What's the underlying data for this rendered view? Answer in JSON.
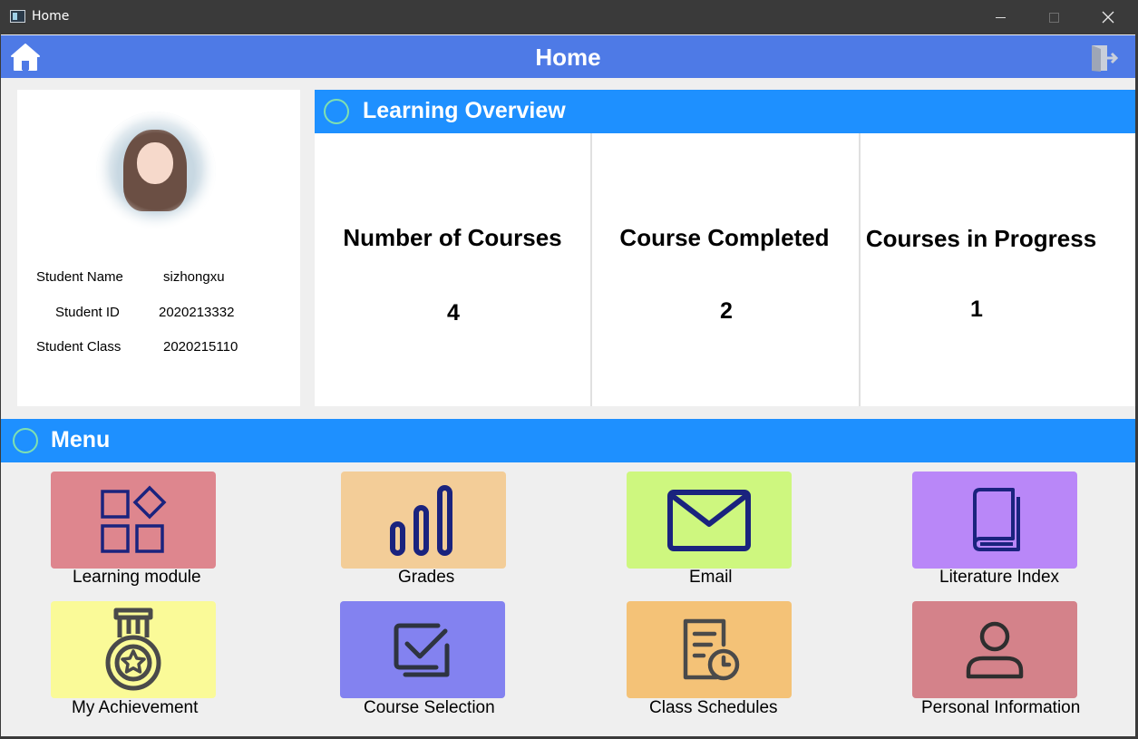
{
  "window": {
    "title": "Home"
  },
  "header": {
    "title": "Home"
  },
  "student": {
    "fields": [
      {
        "label": "Student Name",
        "value": "sizhongxu"
      },
      {
        "label": "Student ID",
        "value": "2020213332"
      },
      {
        "label": "Student Class",
        "value": "2020215110"
      }
    ]
  },
  "overview": {
    "title": "Learning Overview",
    "stats": [
      {
        "label": "Number of Courses",
        "value": "4"
      },
      {
        "label": "Course Completed",
        "value": "2"
      },
      {
        "label": "Courses in Progress",
        "value": "1"
      }
    ]
  },
  "menu": {
    "title": "Menu",
    "items": [
      {
        "label": "Learning module",
        "icon": "grid-icon",
        "color": "#de868e"
      },
      {
        "label": "Grades",
        "icon": "bar-chart-icon",
        "color": "#f3cd98"
      },
      {
        "label": "Email",
        "icon": "envelope-icon",
        "color": "#cef77f"
      },
      {
        "label": "Literature Index",
        "icon": "book-icon",
        "color": "#b987f8"
      },
      {
        "label": "My Achievement",
        "icon": "medal-icon",
        "color": "#fafa98"
      },
      {
        "label": "Course Selection",
        "icon": "checkbox-icon",
        "color": "#8382f0"
      },
      {
        "label": "Class Schedules",
        "icon": "schedule-icon",
        "color": "#f4c277"
      },
      {
        "label": "Personal Information",
        "icon": "user-icon",
        "color": "#d4828a"
      }
    ]
  },
  "colors": {
    "header": "#4e7ae6",
    "section_bar": "#1e90ff",
    "icon_navy": "#1a237e"
  }
}
